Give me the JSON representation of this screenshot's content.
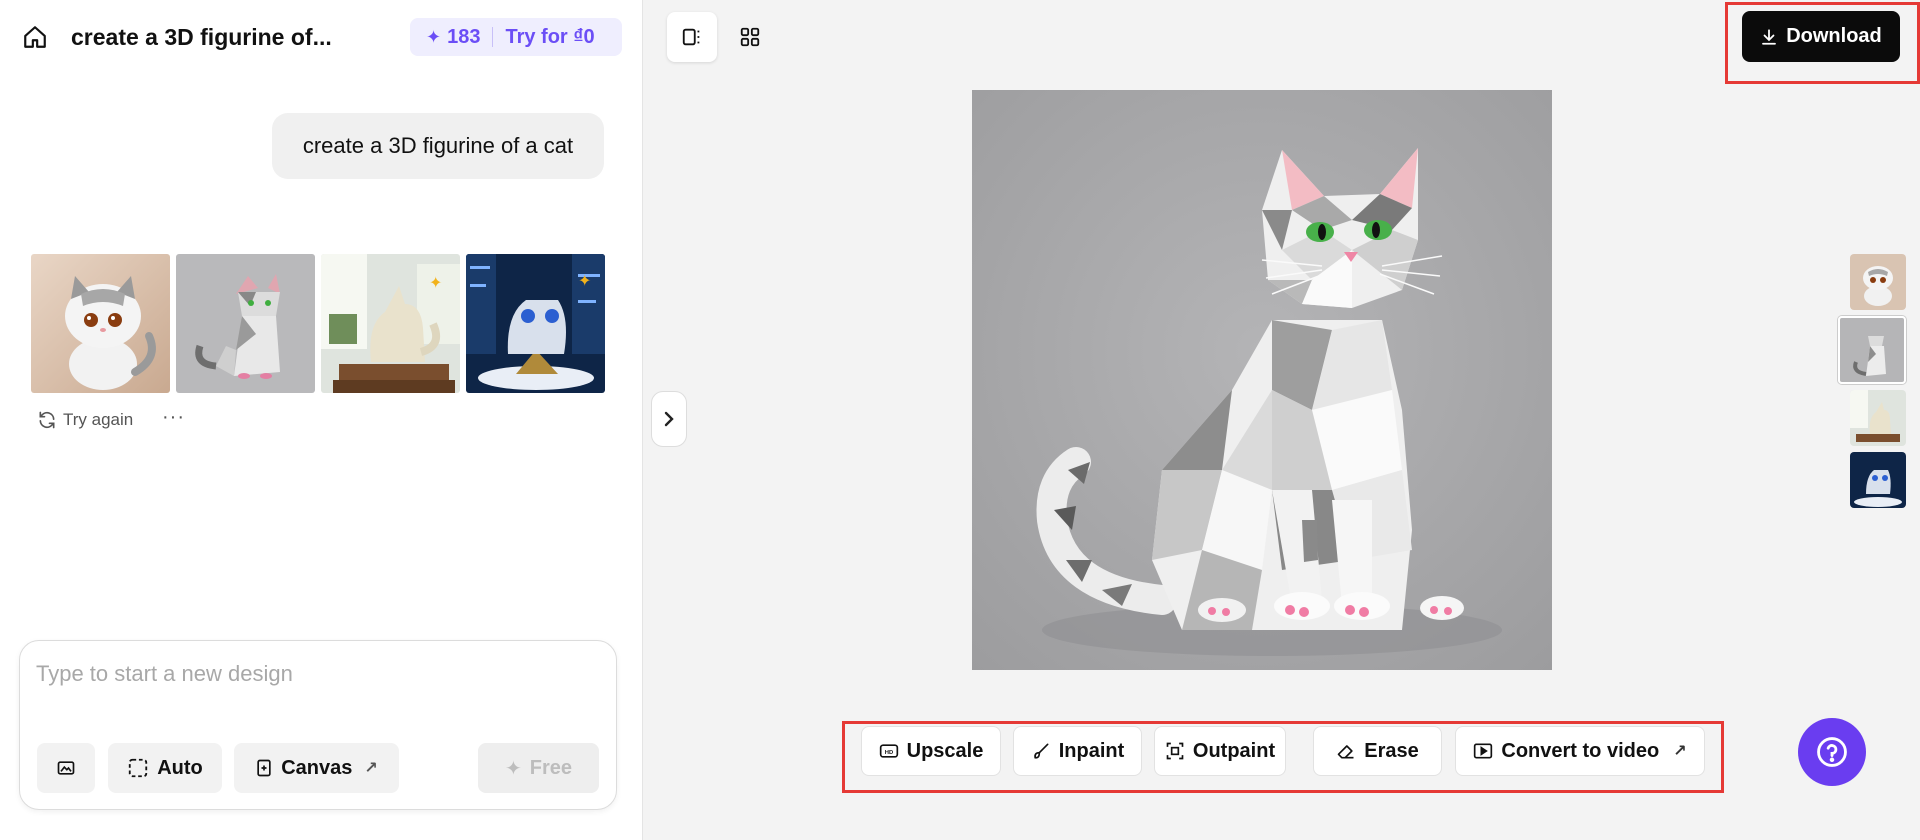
{
  "header": {
    "title": "create a 3D figurine of...",
    "credits": "183",
    "try_label": "Try for ₫0"
  },
  "chat": {
    "prompt": "create a 3D figurine of a cat",
    "try_again": "Try again",
    "more": "···"
  },
  "composer": {
    "placeholder": "Type to start a new design",
    "auto_label": "Auto",
    "canvas_label": "Canvas",
    "free_label": "Free"
  },
  "toolbar": {
    "download_label": "Download"
  },
  "tools": [
    {
      "label": "Upscale",
      "icon": "hd-icon"
    },
    {
      "label": "Inpaint",
      "icon": "brush-icon"
    },
    {
      "label": "Outpaint",
      "icon": "expand-icon"
    },
    {
      "label": "Erase",
      "icon": "eraser-icon"
    },
    {
      "label": "Convert to video",
      "icon": "video-icon"
    }
  ],
  "colors": {
    "accent": "#6b4ef6",
    "help_button": "#6a3df0",
    "download_bg": "#0b0b0b",
    "highlight_box": "#e53935"
  }
}
